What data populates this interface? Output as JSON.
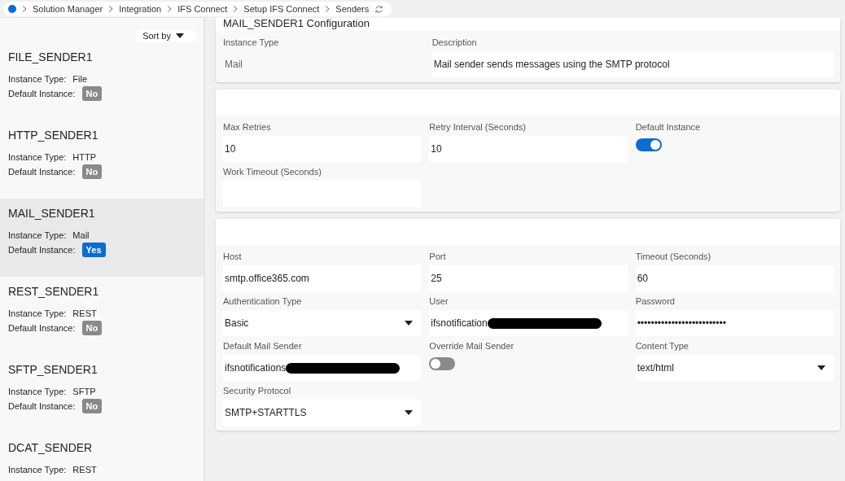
{
  "breadcrumb": {
    "items": [
      "Solution Manager",
      "Integration",
      "IFS Connect",
      "Setup IFS Connect",
      "Senders"
    ]
  },
  "sidebar": {
    "sort_label": "Sort by",
    "items": [
      {
        "name": "FILE_SENDER1",
        "type_label": "Instance Type:",
        "type": "File",
        "default_label": "Default Instance:",
        "default": "No",
        "is_default": false,
        "selected": false
      },
      {
        "name": "HTTP_SENDER1",
        "type_label": "Instance Type:",
        "type": "HTTP",
        "default_label": "Default Instance:",
        "default": "No",
        "is_default": false,
        "selected": false
      },
      {
        "name": "MAIL_SENDER1",
        "type_label": "Instance Type:",
        "type": "Mail",
        "default_label": "Default Instance:",
        "default": "Yes",
        "is_default": true,
        "selected": true
      },
      {
        "name": "REST_SENDER1",
        "type_label": "Instance Type:",
        "type": "REST",
        "default_label": "Default Instance:",
        "default": "No",
        "is_default": false,
        "selected": false
      },
      {
        "name": "SFTP_SENDER1",
        "type_label": "Instance Type:",
        "type": "SFTP",
        "default_label": "Default Instance:",
        "default": "No",
        "is_default": false,
        "selected": false
      },
      {
        "name": "DCAT_SENDER",
        "type_label": "Instance Type:",
        "type": "REST",
        "selected": false
      }
    ]
  },
  "groups": [
    {
      "kind": "summary",
      "title": "MAIL_SENDER1 Configuration",
      "fields": [
        {
          "label": "Instance Type",
          "kind": "readonly",
          "value": "Mail"
        },
        {
          "label": "Description",
          "kind": "text",
          "value": "Mail sender sends messages using the SMTP protocol"
        }
      ]
    },
    {
      "kind": "grid",
      "fields": [
        {
          "label": "Max Retries",
          "kind": "text",
          "value": "10"
        },
        {
          "label": "Retry Interval (Seconds)",
          "kind": "text",
          "value": "10"
        },
        {
          "label": "Default Instance",
          "kind": "toggle",
          "on": true
        },
        {
          "label": "Work Timeout (Seconds)",
          "kind": "text"
        }
      ]
    },
    {
      "kind": "grid",
      "fields": [
        {
          "label": "Host",
          "kind": "text",
          "value": "smtp.office365.com"
        },
        {
          "label": "Port",
          "kind": "text",
          "value": "25"
        },
        {
          "label": "Timeout (Seconds)",
          "kind": "text",
          "value": "60"
        },
        {
          "label": "Authentication Type",
          "kind": "select",
          "value": "Basic"
        },
        {
          "label": "User",
          "kind": "text",
          "value": "ifsnotification",
          "redacted": true
        },
        {
          "label": "Password",
          "kind": "text",
          "value": "••••••••••••••••••••••••••"
        },
        {
          "label": "Default Mail Sender",
          "kind": "text",
          "value": "ifsnotifications",
          "redacted": true
        },
        {
          "label": "Override Mail Sender",
          "kind": "toggle",
          "on": false
        },
        {
          "label": "Content Type",
          "kind": "select",
          "value": "text/html"
        },
        {
          "label": "Security Protocol",
          "kind": "select",
          "value": "SMTP+STARTTLS"
        }
      ]
    }
  ]
}
